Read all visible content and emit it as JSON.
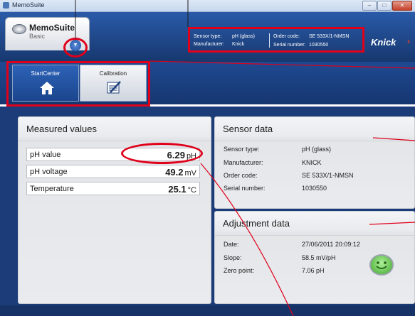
{
  "window": {
    "title": "MemoSuite",
    "controls": {
      "minimize": "–",
      "maximize": "□",
      "close": "✕"
    }
  },
  "header": {
    "product_name": "MemoSuite",
    "edition": "Basic",
    "sensor_type_label": "Sensor type:",
    "sensor_type_value": "pH (glass)",
    "manufacturer_label": "Manufacturer:",
    "manufacturer_value": "Knick",
    "order_code_label": "Order code:",
    "order_code_value": "SE 533X/1-NMSN",
    "serial_label": "Serial number:",
    "serial_value": "1030550",
    "brand": "Knick"
  },
  "tabs": [
    {
      "label": "StartCenter",
      "icon": "home-icon",
      "selected": true
    },
    {
      "label": "Calibration",
      "icon": "calibration-icon",
      "selected": false
    }
  ],
  "measured_values": {
    "title": "Measured values",
    "rows": [
      {
        "label": "pH value",
        "value": "6.29",
        "unit": "pH"
      },
      {
        "label": "pH voltage",
        "value": "49.2",
        "unit": "mV"
      },
      {
        "label": "Temperature",
        "value": "25.1",
        "unit": "°C"
      }
    ]
  },
  "sensor_data": {
    "title": "Sensor data",
    "rows": [
      {
        "label": "Sensor type:",
        "value": "pH (glass)"
      },
      {
        "label": "Manufacturer:",
        "value": "KNICK"
      },
      {
        "label": "Order code:",
        "value": "SE 533X/1-NMSN"
      },
      {
        "label": "Serial number:",
        "value": "1030550"
      }
    ]
  },
  "adjustment_data": {
    "title": "Adjustment data",
    "rows": [
      {
        "label": "Date:",
        "value": "27/06/2011  20:09:12"
      },
      {
        "label": "Slope:",
        "value": "58.5 mV/pH"
      },
      {
        "label": "Zero point:",
        "value": "7.06 pH"
      }
    ],
    "status_icon": "smiley-icon"
  },
  "colors": {
    "header_blue": "#2a5aa8",
    "content_blue": "#1b3c78",
    "annotation_red": "#e0001a",
    "brand_arrow": "#e53b1f"
  }
}
